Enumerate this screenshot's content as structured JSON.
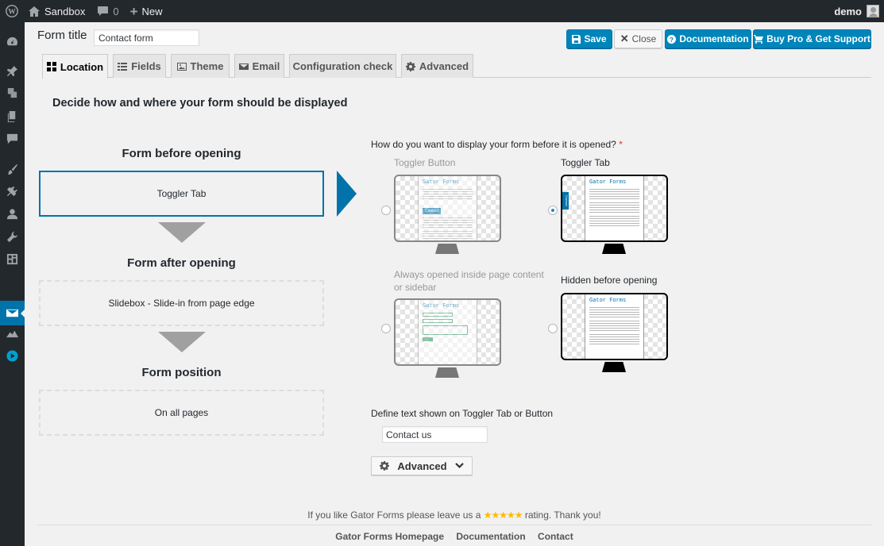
{
  "admin_bar": {
    "site_name": "Sandbox",
    "comments_count": "0",
    "new_label": "New",
    "user_name": "demo"
  },
  "header": {
    "form_title_label": "Form title",
    "form_title_value": "Contact form",
    "save_label": "Save",
    "close_label": "Close",
    "documentation_label": "Documentation",
    "buy_pro_label": "Buy Pro & Get Support"
  },
  "tabs": [
    {
      "label": "Location",
      "icon": "grid-icon",
      "active": true
    },
    {
      "label": "Fields",
      "icon": "list-icon"
    },
    {
      "label": "Theme",
      "icon": "image-icon"
    },
    {
      "label": "Email",
      "icon": "envelope-icon"
    },
    {
      "label": "Configuration check",
      "icon": ""
    },
    {
      "label": "Advanced",
      "icon": "gear-icon"
    }
  ],
  "location": {
    "heading": "Decide how and where your form should be displayed",
    "steps": [
      {
        "title": "Form before opening",
        "value": "Toggler Tab"
      },
      {
        "title": "Form after opening",
        "value": "Slidebox - Slide-in from page edge"
      },
      {
        "title": "Form position",
        "value": "On all pages"
      }
    ],
    "question": "How do you want to display your form before it is opened?",
    "required_mark": "*",
    "options": [
      {
        "label": "Toggler Button",
        "selected": false,
        "enabled": false
      },
      {
        "label": "Toggler Tab",
        "selected": true,
        "enabled": true
      },
      {
        "label": "Always opened inside page content or sidebar",
        "selected": false,
        "enabled": false
      },
      {
        "label": "Hidden before opening",
        "selected": false,
        "enabled": true
      }
    ],
    "preview": {
      "brand": "Gator Forms",
      "button_text": "Contact",
      "tab_text": "Contact"
    },
    "define_label": "Define text shown on Toggler Tab or Button",
    "toggler_text": "Contact us",
    "advanced_label": "Advanced"
  },
  "footer": {
    "rating_before": "If you like Gator Forms please leave us a",
    "stars": "★★★★★",
    "rating_after": "rating. Thank you!",
    "links": [
      "Gator Forms Homepage",
      "Documentation",
      "Contact"
    ]
  },
  "colors": {
    "accent": "#0073aa",
    "button_blue": "#0085ba",
    "admin_bar": "#23282d",
    "star": "#ffb900"
  }
}
